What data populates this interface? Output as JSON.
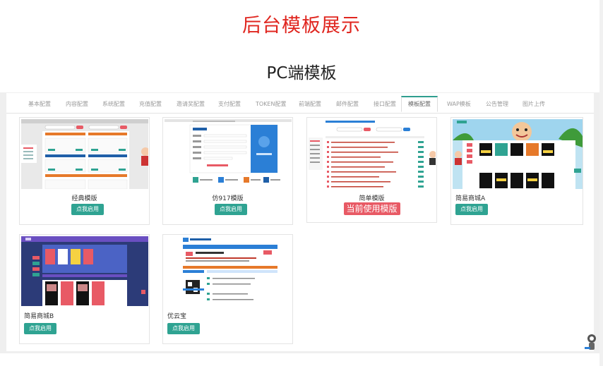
{
  "page": {
    "main_title": "后台模板展示",
    "sub_title": "PC端模板"
  },
  "tabs": [
    {
      "label": "基本配置"
    },
    {
      "label": "内容配置"
    },
    {
      "label": "系统配置"
    },
    {
      "label": "充值配置"
    },
    {
      "label": "邀请奖配置"
    },
    {
      "label": "支付配置"
    },
    {
      "label": "TOKEN配置"
    },
    {
      "label": "前端配置"
    },
    {
      "label": "邮件配置"
    },
    {
      "label": "接口配置"
    },
    {
      "label": "模板配置",
      "active": true
    },
    {
      "label": "WAP模板"
    },
    {
      "label": "公告管理"
    },
    {
      "label": "图片上传"
    }
  ],
  "templates": [
    {
      "name": "经典模版",
      "button": "点我启用"
    },
    {
      "name": "仿917模版",
      "button": "点我启用"
    },
    {
      "name": "简单模版",
      "status": "当前使用模版"
    },
    {
      "name": "简易商城A",
      "button": "点我启用"
    },
    {
      "name": "简易商城B",
      "button": "点我启用"
    },
    {
      "name": "优云宝",
      "button": "点我启用"
    }
  ],
  "colors": {
    "title_red": "#e0261f",
    "button_green": "#2fa392",
    "current_badge": "#e85a65"
  }
}
